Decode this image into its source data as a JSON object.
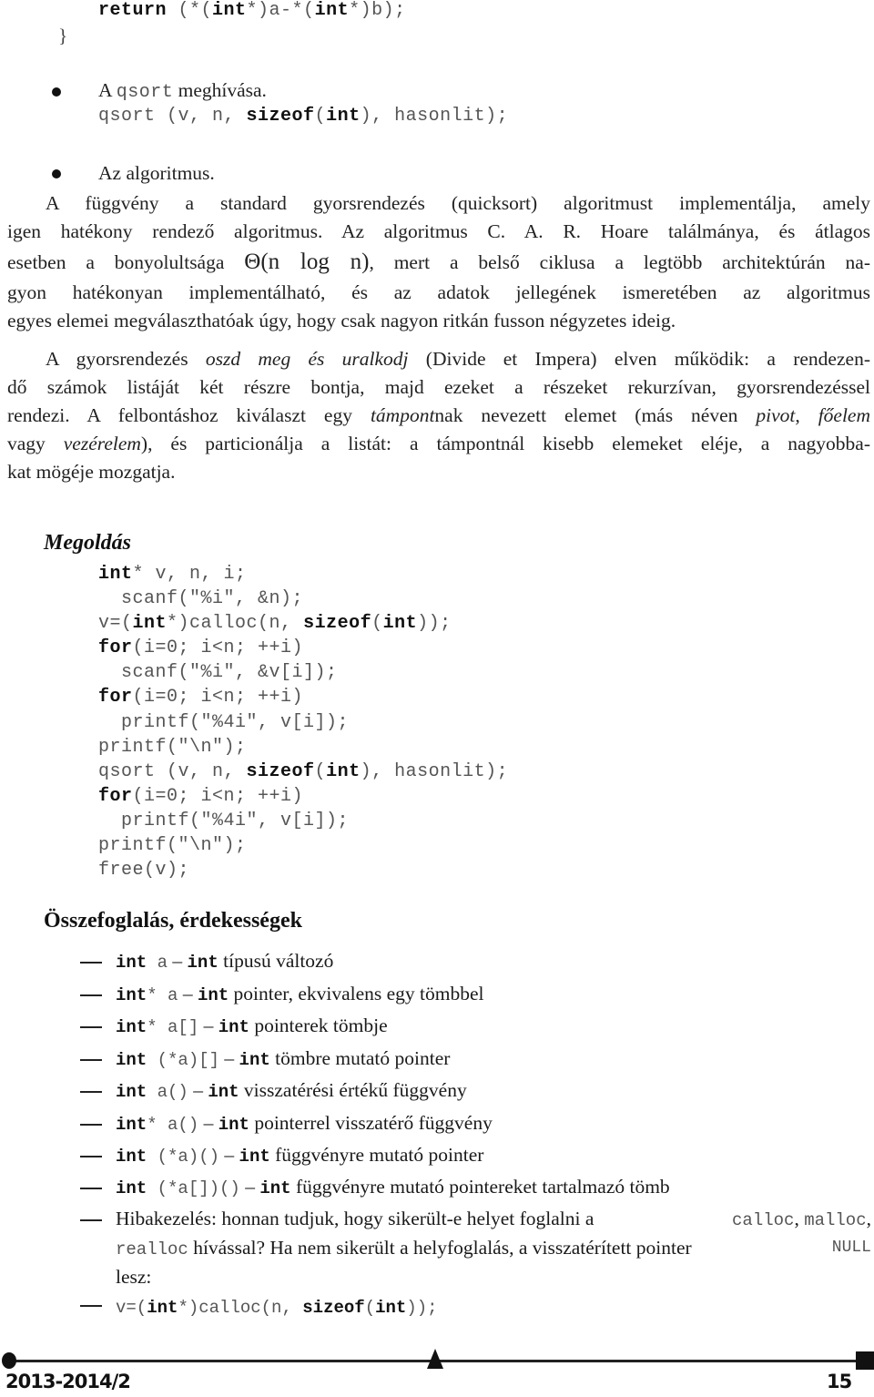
{
  "code_top": {
    "return_kw": "return",
    "return_expr_1": " (*(",
    "int1": "int",
    "return_expr_2": "*)a-*(",
    "int2": "int",
    "return_expr_3": "*)b);",
    "closing_brace": "}"
  },
  "bullets": [
    {
      "lead": "A ",
      "code": "qsort",
      "tail": " meghívása.",
      "call": {
        "pre": "qsort (v, n, ",
        "sizeof_kw": "sizeof",
        "paren_open": "(",
        "int_kw": "int",
        "post": "), hasonlit);"
      }
    },
    {
      "label": "Az algoritmus."
    }
  ],
  "paragraph1": [
    "A függvény a standard gyorsrendezés (quicksort) algoritmust implementálja, amely",
    "igen hatékony rendező algoritmus. Az algoritmus C. A. R. Hoare találmánya, és átlagos",
    {
      "pre": "esetben a bonyolultsága ",
      "math": "Θ(n log n)",
      "post": ", mert a belső ciklusa a legtöbb architektúrán na-"
    },
    "gyon hatékonyan implementálható, és az adatok jellegének ismeretében az algoritmus",
    "egyes elemei megválaszthatóak úgy, hogy csak nagyon ritkán fusson négyzetes ideig."
  ],
  "paragraph2": {
    "l1_pre": "A gyorsrendezés ",
    "l1_it": "oszd meg és uralkodj",
    "l1_post": " (Divide et Impera) elven működik: a rendezen-",
    "l2": "dő számok listáját két részre bontja, majd ezeket a részeket rekurzívan, gyorsrendezéssel",
    "l3_pre": "rendezi. A felbontáshoz kiválaszt egy ",
    "l3_it1": "támpont",
    "l3_mid": "nak nevezett elemet (más néven ",
    "l3_it2": "pivot",
    "l3_comma": ", ",
    "l3_it3": "főelem",
    "l4_pre": "vagy ",
    "l4_it": "vezérelem",
    "l4_post": "), és particionálja a listát: a támpontnál kisebb elemeket eléje, a nagyobba-",
    "l5": "kat mögéje mozgatja."
  },
  "solution": {
    "heading": "Megoldás",
    "lines": [
      [
        {
          "b": "int"
        },
        {
          "t": "* v, n, i;"
        }
      ],
      [
        {
          "t": "  scanf(\"%i\", &n);"
        }
      ],
      [
        {
          "t": "v=("
        },
        {
          "b": "int"
        },
        {
          "t": "*)calloc(n, "
        },
        {
          "b": "sizeof"
        },
        {
          "t": "("
        },
        {
          "b": "int"
        },
        {
          "t": "));"
        }
      ],
      [
        {
          "b": "for"
        },
        {
          "t": "(i=0; i<n; ++i)"
        }
      ],
      [
        {
          "t": "  scanf(\"%i\", &v[i]);"
        }
      ],
      [
        {
          "b": "for"
        },
        {
          "t": "(i=0; i<n; ++i)"
        }
      ],
      [
        {
          "t": "  printf(\"%4i\", v[i]);"
        }
      ],
      [
        {
          "t": "printf(\"\\n\");"
        }
      ],
      [
        {
          "t": "qsort (v, n, "
        },
        {
          "b": "sizeof"
        },
        {
          "t": "("
        },
        {
          "b": "int"
        },
        {
          "t": "), hasonlit);"
        }
      ],
      [
        {
          "b": "for"
        },
        {
          "t": "(i=0; i<n; ++i)"
        }
      ],
      [
        {
          "t": "  printf(\"%4i\", v[i]);"
        }
      ],
      [
        {
          "t": "printf(\"\\n\");"
        }
      ],
      [
        {
          "t": "free(v);"
        }
      ]
    ]
  },
  "summary": {
    "heading": "Összefoglalás, érdekességek",
    "items": [
      {
        "kw": "int",
        "decl": " a",
        "sep": " – ",
        "kw2": "int",
        "desc": " típusú változó"
      },
      {
        "kw": "int",
        "decl": "* a",
        "sep": " – ",
        "kw2": "int",
        "desc": " pointer, ekvivalens egy tömbbel"
      },
      {
        "kw": "int",
        "decl": "* a[]",
        "sep": " – ",
        "kw2": "int",
        "desc": " pointerek tömbje"
      },
      {
        "kw": "int",
        "decl": " (*a)[]",
        "sep": " – ",
        "kw2": "int",
        "desc": " tömbre mutató pointer"
      },
      {
        "kw": "int",
        "decl": " a()",
        "sep": " – ",
        "kw2": "int",
        "desc": " visszatérési értékű függvény"
      },
      {
        "kw": "int",
        "decl": "* a()",
        "sep": " – ",
        "kw2": "int",
        "desc": " pointerrel visszatérő függvény"
      },
      {
        "kw": "int",
        "decl": " (*a)()",
        "sep": " – ",
        "kw2": "int",
        "desc": " függvényre mutató pointer"
      },
      {
        "kw": "int",
        "decl": " (*a[])()",
        "sep": " – ",
        "kw2": "int",
        "desc": " függvényre mutató pointereket tartalmazó tömb"
      }
    ],
    "error_item": {
      "l1_pre": "Hibakezelés: honnan tudjuk, hogy sikerült-e helyet foglalni a ",
      "calloc": "calloc",
      "comma1": ", ",
      "malloc": "malloc",
      "comma2": ",",
      "realloc": "realloc",
      "l2_mid": " hívással? Ha nem sikerült a helyfoglalás, a visszatérített pointer ",
      "null": "NULL",
      "l3": "lesz:"
    },
    "last_item": {
      "pre": "v=(",
      "int1": "int",
      "mid": "*)calloc(n, ",
      "sizeof_kw": "sizeof",
      "open": "(",
      "int2": "int",
      "post": "));"
    }
  },
  "footer": {
    "semester": "2013-2014/2",
    "page_number": "15"
  }
}
